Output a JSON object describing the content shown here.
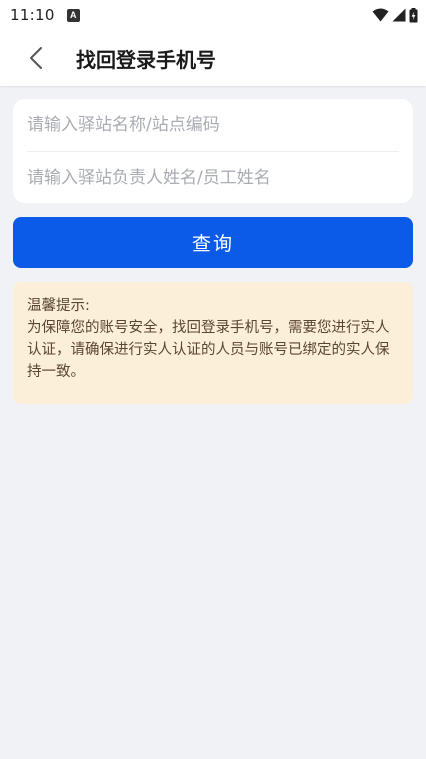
{
  "status_bar": {
    "time": "11:10",
    "notification_icon_label": "A",
    "icons": [
      "wifi-icon",
      "signal-icon",
      "battery-icon"
    ]
  },
  "header": {
    "back_icon": "chevron-left-icon",
    "title": "找回登录手机号"
  },
  "form": {
    "station_field": {
      "value": "",
      "placeholder": "请输入驿站名称/站点编码"
    },
    "name_field": {
      "value": "",
      "placeholder": "请输入驿站负责人姓名/员工姓名"
    }
  },
  "query_button": {
    "label": "查询"
  },
  "tip": {
    "title": "温馨提示:",
    "body": "为保障您的账号安全，找回登录手机号，需要您进行实人认证，请确保进行实人认证的人员与账号已绑定的实人保持一致。"
  },
  "colors": {
    "primary": "#0c5be8",
    "page_background": "#f1f2f6",
    "tip_background": "#fcefd9",
    "tip_text": "#5a4630"
  }
}
